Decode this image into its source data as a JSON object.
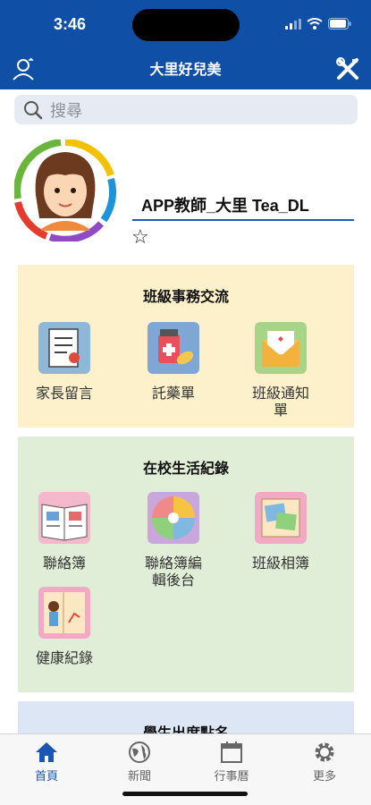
{
  "status_bar": {
    "time": "3:46"
  },
  "nav": {
    "title": "大里好兒美",
    "left_icon": "profile-swap-icon",
    "right_icon": "tools-icon"
  },
  "search": {
    "placeholder": "搜尋"
  },
  "profile": {
    "name": "APP教師_大里 Tea_DL",
    "favorite_icon": "star-outline-icon"
  },
  "sections": [
    {
      "title": "班級事務交流",
      "bg": "#fdf1cc",
      "items": [
        {
          "label": "家長留言",
          "icon": "parent-message-icon"
        },
        {
          "label": "託藥單",
          "icon": "medicine-form-icon"
        },
        {
          "label": "班級通知單",
          "icon": "class-notice-icon"
        }
      ]
    },
    {
      "title": "在校生活紀錄",
      "bg": "#e0eed8",
      "items": [
        {
          "label": "聯絡簿",
          "icon": "contact-book-icon"
        },
        {
          "label": "聯絡簿編輯後台",
          "icon": "contact-book-admin-icon"
        },
        {
          "label": "班級相簿",
          "icon": "class-album-icon"
        },
        {
          "label": "健康紀錄",
          "icon": "health-record-icon"
        }
      ]
    },
    {
      "title": "學生出席點名",
      "bg": "#dde6f4"
    }
  ],
  "tabs": [
    {
      "label": "首頁",
      "icon": "home-icon",
      "active": true
    },
    {
      "label": "新聞",
      "icon": "globe-icon",
      "active": false
    },
    {
      "label": "行事曆",
      "icon": "calendar-icon",
      "active": false
    },
    {
      "label": "更多",
      "icon": "gear-icon",
      "active": false
    }
  ],
  "colors": {
    "header": "#0f4fa6",
    "accent": "#1b56b4"
  }
}
